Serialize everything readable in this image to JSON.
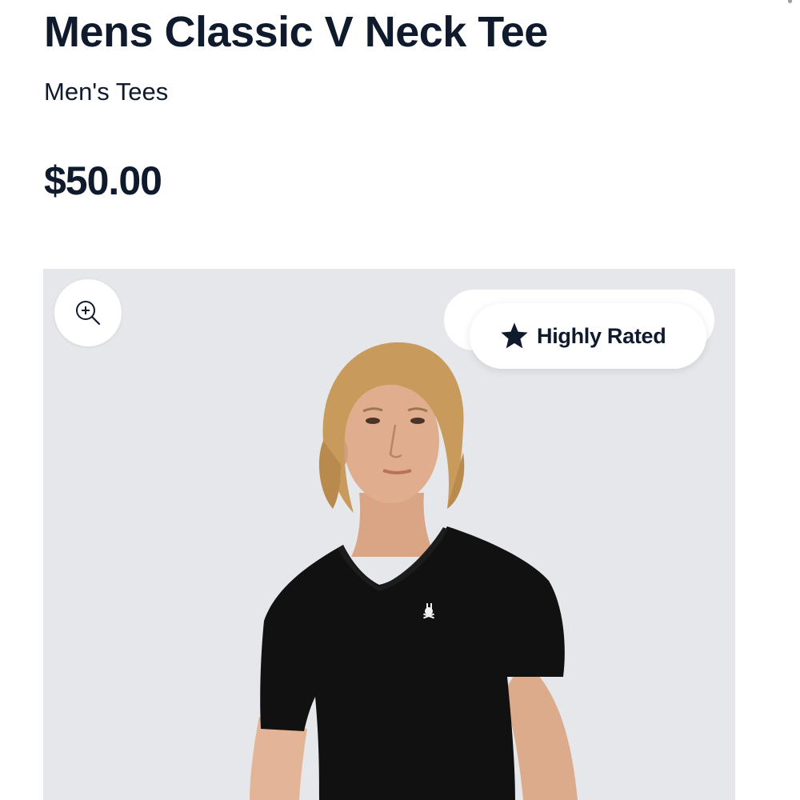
{
  "product": {
    "title": "Mens Classic V Neck Tee",
    "category": "Men's Tees",
    "price": "$50.00"
  },
  "gallery": {
    "zoom_icon": "zoom-in-icon",
    "badge": {
      "icon": "star-icon",
      "label": "Highly Rated"
    }
  },
  "colors": {
    "text": "#0f1b2d",
    "gallery_background": "#e6e7ea",
    "shirt": "#111111"
  }
}
